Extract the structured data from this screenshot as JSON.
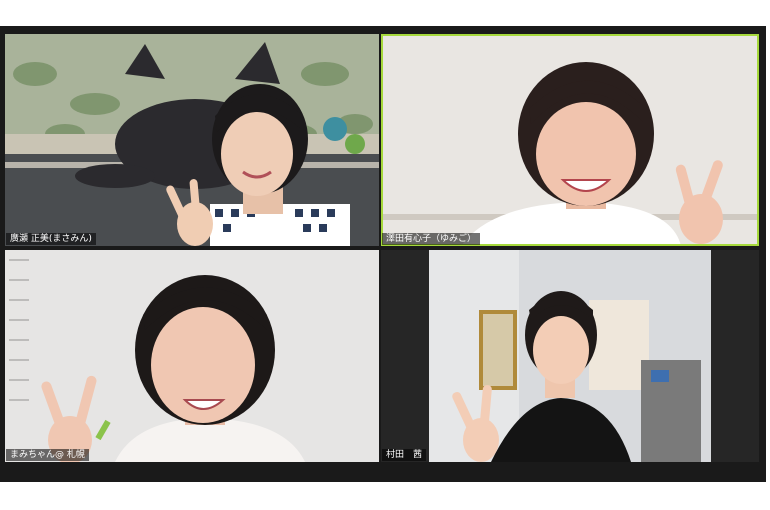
{
  "participants": [
    {
      "name": "廣瀬 正美(まさみん)",
      "background": "#8f9a86",
      "active": false
    },
    {
      "name": "澤田有心子（ゆみご）",
      "background": "#e9e6e2",
      "active": true
    },
    {
      "name": "まみちゃん@ 札幌",
      "background": "#e6e5e4",
      "active": false
    },
    {
      "name": "村田　茜",
      "background": "#d8dadd",
      "active": false
    }
  ],
  "colors": {
    "active_speaker_border": "#a6d93c",
    "window_background": "#1a1a1a"
  }
}
